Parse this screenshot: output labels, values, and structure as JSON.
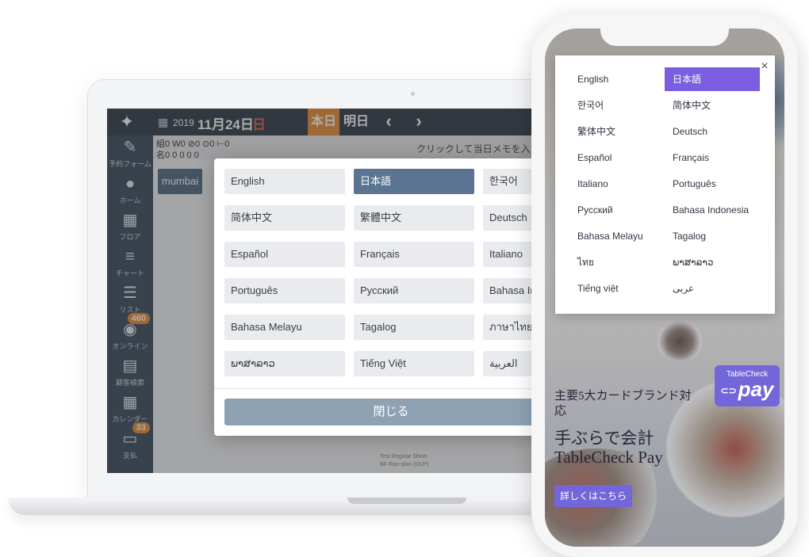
{
  "laptop": {
    "header": {
      "year": "2019",
      "date": "11月24日",
      "weekday": "日",
      "today_label": "本日",
      "tomorrow_label": "明日",
      "prev_glyph": "‹",
      "next_glyph": "›",
      "status_line1": "組0 W0 ⊘0 ⊙0 ⊢0",
      "status_line2": "名0   0   0   0   0",
      "memo_hint": "クリックして当日メモを入力"
    },
    "sidebar": [
      {
        "label": "予約フォーム",
        "icon": "✎"
      },
      {
        "label": "ホーム",
        "icon": "●"
      },
      {
        "label": "フロア",
        "icon": "▦"
      },
      {
        "label": "チャート",
        "icon": "≡"
      },
      {
        "label": "リスト",
        "icon": "☰"
      },
      {
        "label": "オンライン",
        "icon": "◉",
        "badge": "460"
      },
      {
        "label": "顧客検索",
        "icon": "▤"
      },
      {
        "label": "カレンダー",
        "icon": "▦"
      },
      {
        "label": "支払",
        "icon": "▭",
        "badge": "33"
      }
    ],
    "room_tab": "mumbai",
    "language_modal": {
      "selected": "日本語",
      "languages": [
        "English",
        "日本語",
        "한국어",
        "简体中文",
        "繁體中文",
        "Deutsch",
        "Español",
        "Français",
        "Italiano",
        "Português",
        "Русский",
        "Bahasa Indo",
        "Bahasa Melayu",
        "Tagalog",
        "ภาษาไทย",
        "ພາສາລາວ",
        "Tiếng Việt",
        "العربية"
      ],
      "close_label": "閉じる"
    },
    "footnote": [
      "Test Regular Sheet",
      "BF-floor-plan (DUP)"
    ]
  },
  "phone": {
    "language_modal": {
      "selected": "日本語",
      "languages": [
        "English",
        "日本語",
        "한국어",
        "简体中文",
        "繁体中文",
        "Deutsch",
        "Español",
        "Français",
        "Italiano",
        "Português",
        "Русский",
        "Bahasa Indonesia",
        "Bahasa Melayu",
        "Tagalog",
        "ไทย",
        "ພາສາລາວ",
        "Tiếng việt",
        "عربى"
      ],
      "close_glyph": "×"
    },
    "promo": {
      "line1": "主要5大カードブランド対応",
      "line2": "手ぶらで会計 TableCheck Pay",
      "badge_small": "TableCheck",
      "badge_big": "pay",
      "badge_glyph": "⊂⊃",
      "button_label": "詳しくはこちら"
    }
  },
  "colors": {
    "nav_dark": "#1f2d3a",
    "sidebar": "#2c3e50",
    "accent_orange": "#e98426",
    "selected_slate": "#5a7491",
    "close_button": "#8fa2b4",
    "brand_purple": "#7366d9"
  }
}
